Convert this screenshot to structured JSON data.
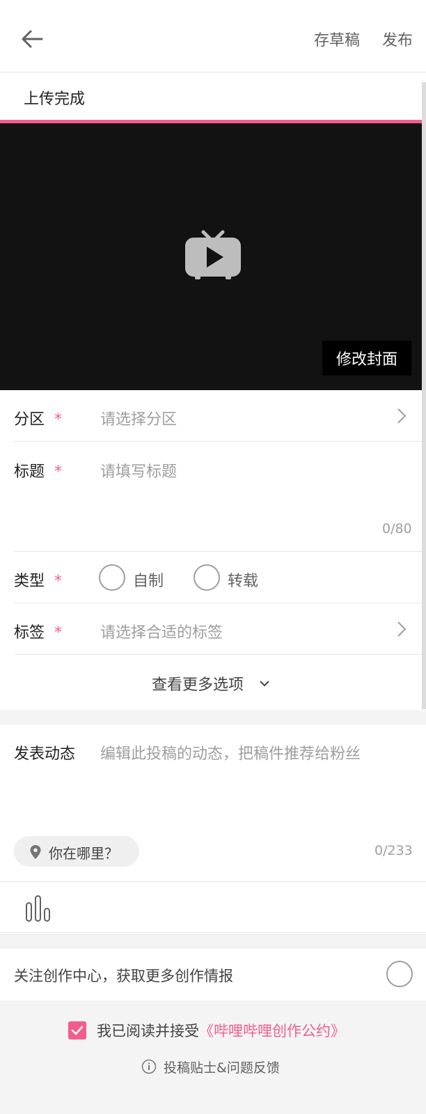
{
  "header": {
    "back_icon": "arrow-left-icon",
    "draft_label": "存草稿",
    "publish_label": "发布"
  },
  "upload": {
    "status_text": "上传完成",
    "progress_percent": 100,
    "progress_color": "#f25d8e"
  },
  "video": {
    "placeholder_icon": "tv-play-icon",
    "change_cover_label": "修改封面"
  },
  "form": {
    "category": {
      "label": "分区",
      "required_mark": "*",
      "placeholder": "请选择分区"
    },
    "title": {
      "label": "标题",
      "required_mark": "*",
      "placeholder": "请填写标题",
      "counter": "0/80"
    },
    "type": {
      "label": "类型",
      "required_mark": "*",
      "options": [
        "自制",
        "转载"
      ]
    },
    "tags": {
      "label": "标签",
      "required_mark": "*",
      "placeholder": "请选择合适的标签"
    },
    "more_options_label": "查看更多选项"
  },
  "dynamic": {
    "label": "发表动态",
    "placeholder": "编辑此投稿的动态，把稿件推荐给粉丝",
    "location_label": "你在哪里？",
    "counter": "0/233"
  },
  "follow": {
    "text": "关注创作中心，获取更多创作情报"
  },
  "agreement": {
    "prefix": "我已阅读并接受",
    "link": "《哔哩哔哩创作公约》",
    "checked": true
  },
  "tips": {
    "label": "投稿贴士&问题反馈"
  },
  "colors": {
    "accent": "#f25d8e",
    "video_bg": "#121212"
  }
}
